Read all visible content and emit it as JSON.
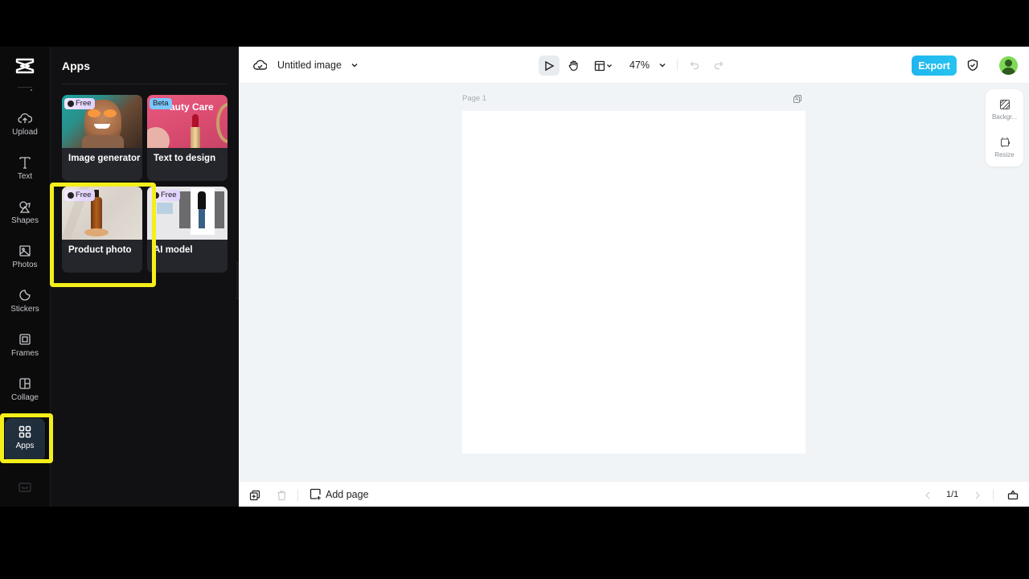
{
  "rail": {
    "items": [
      {
        "label": "Upload",
        "icon": "cloud-upload-icon"
      },
      {
        "label": "Text",
        "icon": "text-icon"
      },
      {
        "label": "Shapes",
        "icon": "shapes-icon"
      },
      {
        "label": "Photos",
        "icon": "photos-icon"
      },
      {
        "label": "Stickers",
        "icon": "stickers-icon"
      },
      {
        "label": "Frames",
        "icon": "frames-icon"
      },
      {
        "label": "Collage",
        "icon": "collage-icon"
      },
      {
        "label": "Apps",
        "icon": "apps-grid-icon",
        "active": true
      }
    ]
  },
  "panel": {
    "title": "Apps",
    "cards": [
      {
        "label": "Image generator",
        "badge": "Free"
      },
      {
        "label": "Text to design",
        "badge": "Beta",
        "thumb_text": "auty Care"
      },
      {
        "label": "Product photo",
        "badge": "Free"
      },
      {
        "label": "AI model",
        "badge": "Free"
      }
    ]
  },
  "topbar": {
    "title": "Untitled image",
    "zoom": "47%",
    "export_label": "Export"
  },
  "canvas": {
    "page_label": "Page 1"
  },
  "side_tools": [
    {
      "label": "Backgr..."
    },
    {
      "label": "Resize"
    }
  ],
  "bottombar": {
    "add_page_label": "Add page",
    "pager": "1/1"
  },
  "colors": {
    "accent": "#1fb6f0",
    "highlight": "#f4ef1a",
    "canvas_bg": "#f1f4f7"
  }
}
